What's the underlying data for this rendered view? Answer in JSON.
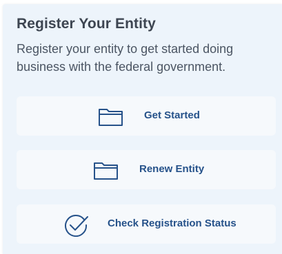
{
  "panel": {
    "title": "Register Your Entity",
    "description": "Register your entity to get started doing business with the federal government."
  },
  "actions": [
    {
      "label": "Get Started",
      "icon": "folder-icon"
    },
    {
      "label": "Renew Entity",
      "icon": "folder-icon"
    },
    {
      "label": "Check Registration Status",
      "icon": "check-circle-icon"
    }
  ],
  "colors": {
    "panel_background": "#edf4fb",
    "button_background": "#f6f9fc",
    "title_text": "#3d4551",
    "body_text": "#4b5563",
    "link_text": "#26528a",
    "icon_stroke": "#26528a"
  }
}
